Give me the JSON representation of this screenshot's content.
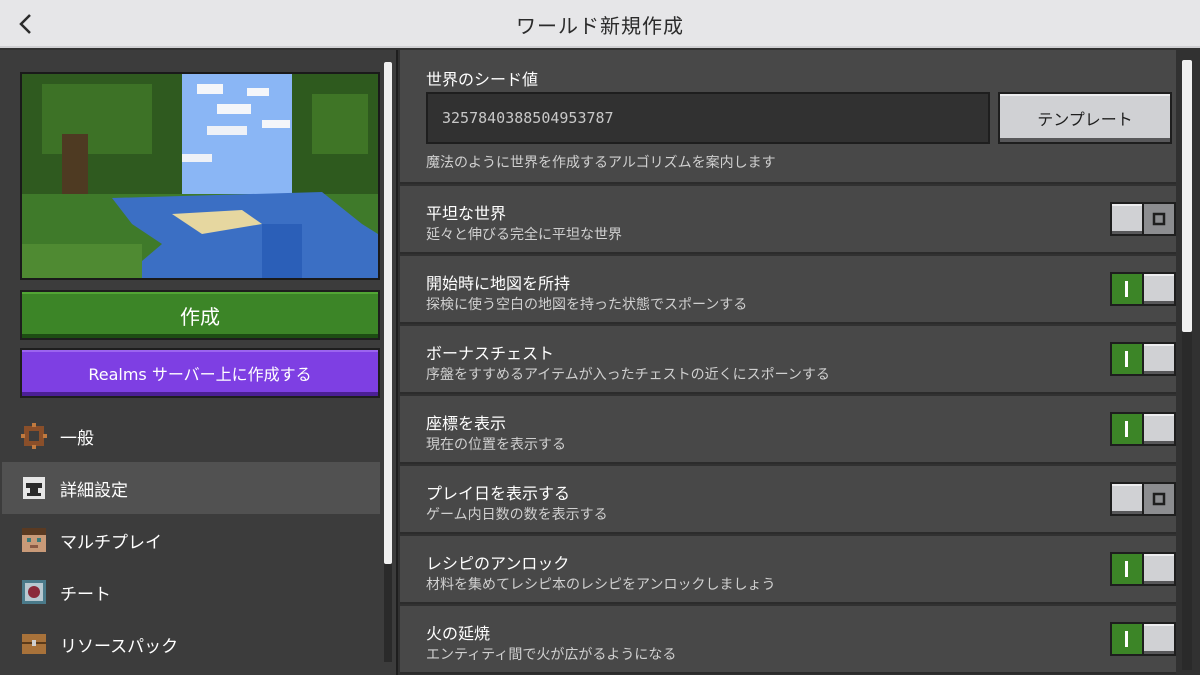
{
  "header": {
    "title": "ワールド新規作成",
    "back_icon": "chevron-left-icon"
  },
  "left": {
    "create_label": "作成",
    "realms_label": "Realms サーバー上に作成する",
    "nav": [
      {
        "label": "一般",
        "icon": "gear-icon",
        "active": false
      },
      {
        "label": "詳細設定",
        "icon": "anvil-icon",
        "active": true
      },
      {
        "label": "マルチプレイ",
        "icon": "player-head-icon",
        "active": false
      },
      {
        "label": "チート",
        "icon": "command-block-icon",
        "active": false
      },
      {
        "label": "リソースパック",
        "icon": "chest-icon",
        "active": false
      }
    ]
  },
  "seed": {
    "title": "世界のシード値",
    "value": "3257840388504953787",
    "template_label": "テンプレート",
    "description": "魔法のように世界を作成するアルゴリズムを案内します"
  },
  "settings": [
    {
      "title": "平坦な世界",
      "description": "延々と伸びる完全に平坦な世界",
      "on": false
    },
    {
      "title": "開始時に地図を所持",
      "description": "探検に使う空白の地図を持った状態でスポーンする",
      "on": true
    },
    {
      "title": "ボーナスチェスト",
      "description": "序盤をすすめるアイテムが入ったチェストの近くにスポーンする",
      "on": true
    },
    {
      "title": "座標を表示",
      "description": "現在の位置を表示する",
      "on": true
    },
    {
      "title": "プレイ日を表示する",
      "description": "ゲーム内日数の数を表示する",
      "on": false
    },
    {
      "title": "レシピのアンロック",
      "description": "材料を集めてレシピ本のレシピをアンロックしましょう",
      "on": true
    },
    {
      "title": "火の延焼",
      "description": "エンティティ間で火が広がるようになる",
      "on": true
    }
  ],
  "colors": {
    "create_green": "#3c8527",
    "realms_purple": "#7e3fe3",
    "toggle_on": "#3c8527",
    "toggle_off": "#8c8d90"
  }
}
